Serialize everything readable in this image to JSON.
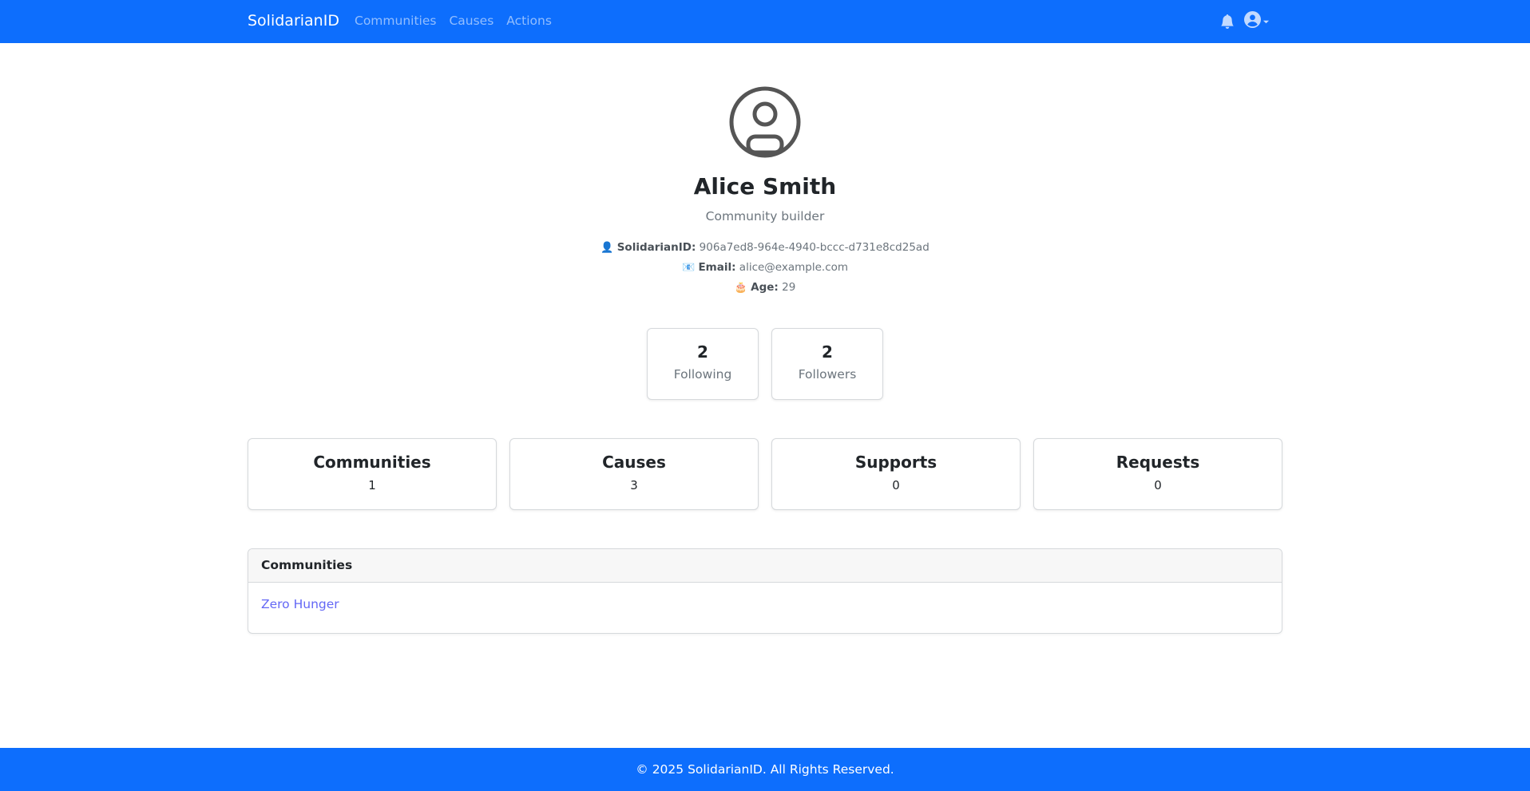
{
  "navbar": {
    "brand": "SolidarianID",
    "links": [
      "Communities",
      "Causes",
      "Actions"
    ],
    "icons": {
      "notifications": "bell-icon",
      "user": "user-circle-icon",
      "caret": "caret-down-icon"
    }
  },
  "profile": {
    "avatar_icon": "user-avatar-icon",
    "name": "Alice Smith",
    "bio": "Community builder",
    "solidarian_id": {
      "emoji": "👤",
      "label": "SolidarianID:",
      "value": "906a7ed8-964e-4940-bccc-d731e8cd25ad"
    },
    "email": {
      "emoji": "📧",
      "label": "Email:",
      "value": "alice@example.com"
    },
    "age": {
      "emoji": "🎂",
      "label": "Age:",
      "value": "29"
    }
  },
  "follow": {
    "following": {
      "count": "2",
      "label": "Following"
    },
    "followers": {
      "count": "2",
      "label": "Followers"
    }
  },
  "stats": [
    {
      "title": "Communities",
      "value": "1"
    },
    {
      "title": "Causes",
      "value": "3"
    },
    {
      "title": "Supports",
      "value": "0"
    },
    {
      "title": "Requests",
      "value": "0"
    }
  ],
  "communities_card": {
    "header": "Communities",
    "items": [
      "Zero Hunger"
    ]
  },
  "footer": {
    "text": "© 2025 SolidarianID. All Rights Reserved."
  },
  "colors": {
    "primary": "#0d6efd",
    "link": "#6367f5",
    "muted": "#6c757d"
  }
}
